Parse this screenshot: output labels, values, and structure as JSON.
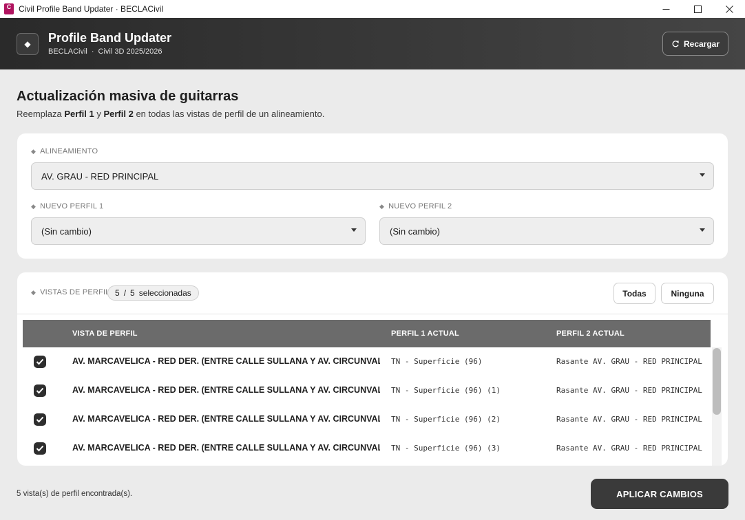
{
  "window": {
    "title": "Civil Profile Band Updater · BECLACivil",
    "icon_letter": "C",
    "controls": [
      "minimize-icon",
      "maximize-icon",
      "close-icon"
    ]
  },
  "header": {
    "title": "Profile Band Updater",
    "company": "BECLACivil",
    "separator": "·",
    "version": "Civil 3D 2025/2026",
    "reload_label": "Recargar",
    "reload_icon": "refresh-icon"
  },
  "page": {
    "title": "Actualización masiva de guitarras",
    "desc_prefix": "Reemplaza ",
    "desc_p1": "Perfil 1",
    "desc_mid": " y ",
    "desc_p2": "Perfil 2",
    "desc_suffix": " en todas las vistas de perfil de un alineamiento."
  },
  "form": {
    "alignment_label": "ALINEAMIENTO",
    "alignment_value": "AV. GRAU - RED PRINCIPAL",
    "profile1_label": "NUEVO PERFIL 1",
    "profile1_value": "(Sin cambio)",
    "profile2_label": "NUEVO PERFIL 2",
    "profile2_value": "(Sin cambio)"
  },
  "views": {
    "label": "VISTAS DE PERFIL",
    "selected": "5",
    "slash": "/",
    "total": "5",
    "selected_word": "seleccionadas",
    "all_label": "Todas",
    "none_label": "Ninguna",
    "columns": [
      "VISTA DE PERFIL",
      "PERFIL 1 ACTUAL",
      "PERFIL 2 ACTUAL"
    ],
    "rows": [
      {
        "checked": true,
        "name": "AV. MARCAVELICA - RED DER. (ENTRE CALLE SULLANA Y AV. CIRCUNVALACION)",
        "p1": "TN - Superficie (96)",
        "p2": "Rasante AV. GRAU - RED PRINCIPAL"
      },
      {
        "checked": true,
        "name": "AV. MARCAVELICA - RED DER. (ENTRE CALLE SULLANA Y AV. CIRCUNVALACION)",
        "p1": "TN - Superficie (96) (1)",
        "p2": "Rasante AV. GRAU - RED PRINCIPAL"
      },
      {
        "checked": true,
        "name": "AV. MARCAVELICA - RED DER. (ENTRE CALLE SULLANA Y AV. CIRCUNVALACION)",
        "p1": "TN - Superficie (96) (2)",
        "p2": "Rasante AV. GRAU - RED PRINCIPAL"
      },
      {
        "checked": true,
        "name": "AV. MARCAVELICA - RED DER. (ENTRE CALLE SULLANA Y AV. CIRCUNVALACION)",
        "p1": "TN - Superficie (96) (3)",
        "p2": "Rasante AV. GRAU - RED PRINCIPAL"
      }
    ]
  },
  "footer": {
    "status": "5 vista(s) de perfil encontrada(s).",
    "apply_label": "APLICAR CAMBIOS"
  }
}
